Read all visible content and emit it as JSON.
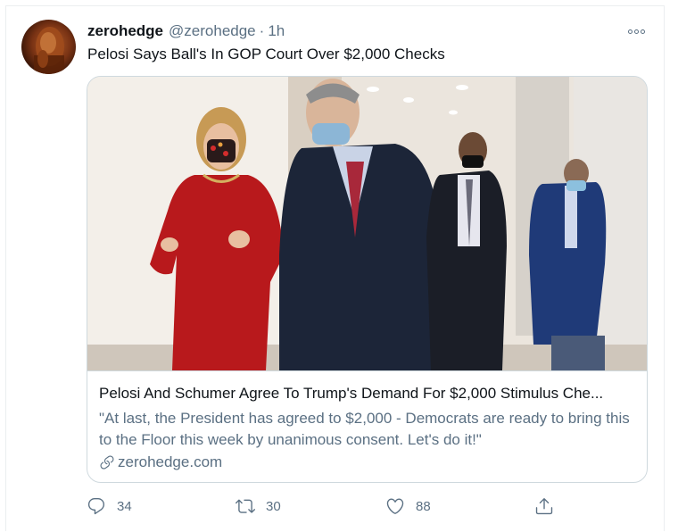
{
  "tweet": {
    "display_name": "zerohedge",
    "handle": "@zerohedge",
    "separator": "·",
    "time": "1h",
    "text": "Pelosi Says Ball's In GOP Court Over $2,000 Checks",
    "avatar_icon": "avatar-image",
    "more_icon": "more-icon"
  },
  "card": {
    "image_icon": "photo",
    "title": "Pelosi And Schumer Agree To Trump's Demand For $2,000 Stimulus Che...",
    "description": "\"At last, the President has agreed to $2,000 - Democrats are ready to bring this to the Floor this week by unanimous consent. Let's do it!\"",
    "domain": "zerohedge.com",
    "domain_icon": "link-icon"
  },
  "actions": {
    "reply": {
      "icon": "reply-icon",
      "count": "34"
    },
    "retweet": {
      "icon": "retweet-icon",
      "count": "30"
    },
    "like": {
      "icon": "heart-icon",
      "count": "88"
    },
    "share": {
      "icon": "share-icon"
    }
  },
  "colors": {
    "secondary_text": "#5b7083",
    "primary_text": "#0f1419",
    "border": "#cfd9de"
  }
}
